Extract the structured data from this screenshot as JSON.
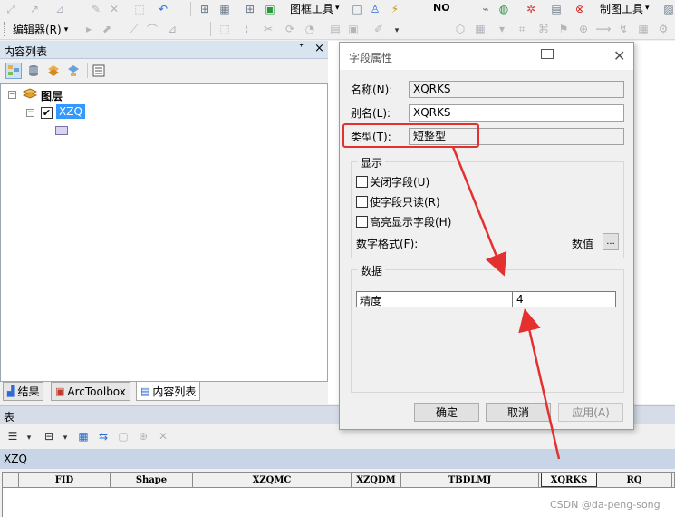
{
  "toolbar": {
    "editor_label": "编辑器(R)",
    "map_tools_label": "图框工具",
    "draw_tools_label": "制图工具",
    "no_label": "NO"
  },
  "toc": {
    "title": "内容列表",
    "pin_symbol": "ᐩ",
    "close_symbol": "×",
    "layers_label": "图层",
    "layer_name": "XZQ",
    "tabs": [
      {
        "label": "结果"
      },
      {
        "label": "ArcToolbox"
      },
      {
        "label": "内容列表"
      }
    ]
  },
  "table": {
    "title": "表",
    "name": "XZQ",
    "columns": [
      "FID",
      "Shape",
      "XZQMC",
      "XZQDM",
      "TBDLMJ",
      "XQRKS",
      "RQ"
    ],
    "selected_column": "XQRKS"
  },
  "dialog": {
    "title": "字段属性",
    "name_label": "名称(N):",
    "name_value": "XQRKS",
    "alias_label": "别名(L):",
    "alias_value": "XQRKS",
    "type_label": "类型(T):",
    "type_value": "短整型",
    "display_group": "显示",
    "checkbox_hide": "关闭字段(U)",
    "checkbox_readonly": "使字段只读(R)",
    "checkbox_highlight": "高亮显示字段(H)",
    "number_format_label": "数字格式(F):",
    "number_format_value": "数值",
    "ellipsis": "...",
    "data_group": "数据",
    "precision_label": "精度",
    "precision_value": "4",
    "ok_label": "确定",
    "cancel_label": "取消",
    "apply_label": "应用(A)"
  },
  "watermark": "CSDN @da-peng-song",
  "colors": {
    "annotation_red": "#e53030",
    "panel_header": "#d9e4f1",
    "selection_blue": "#3399ff"
  }
}
